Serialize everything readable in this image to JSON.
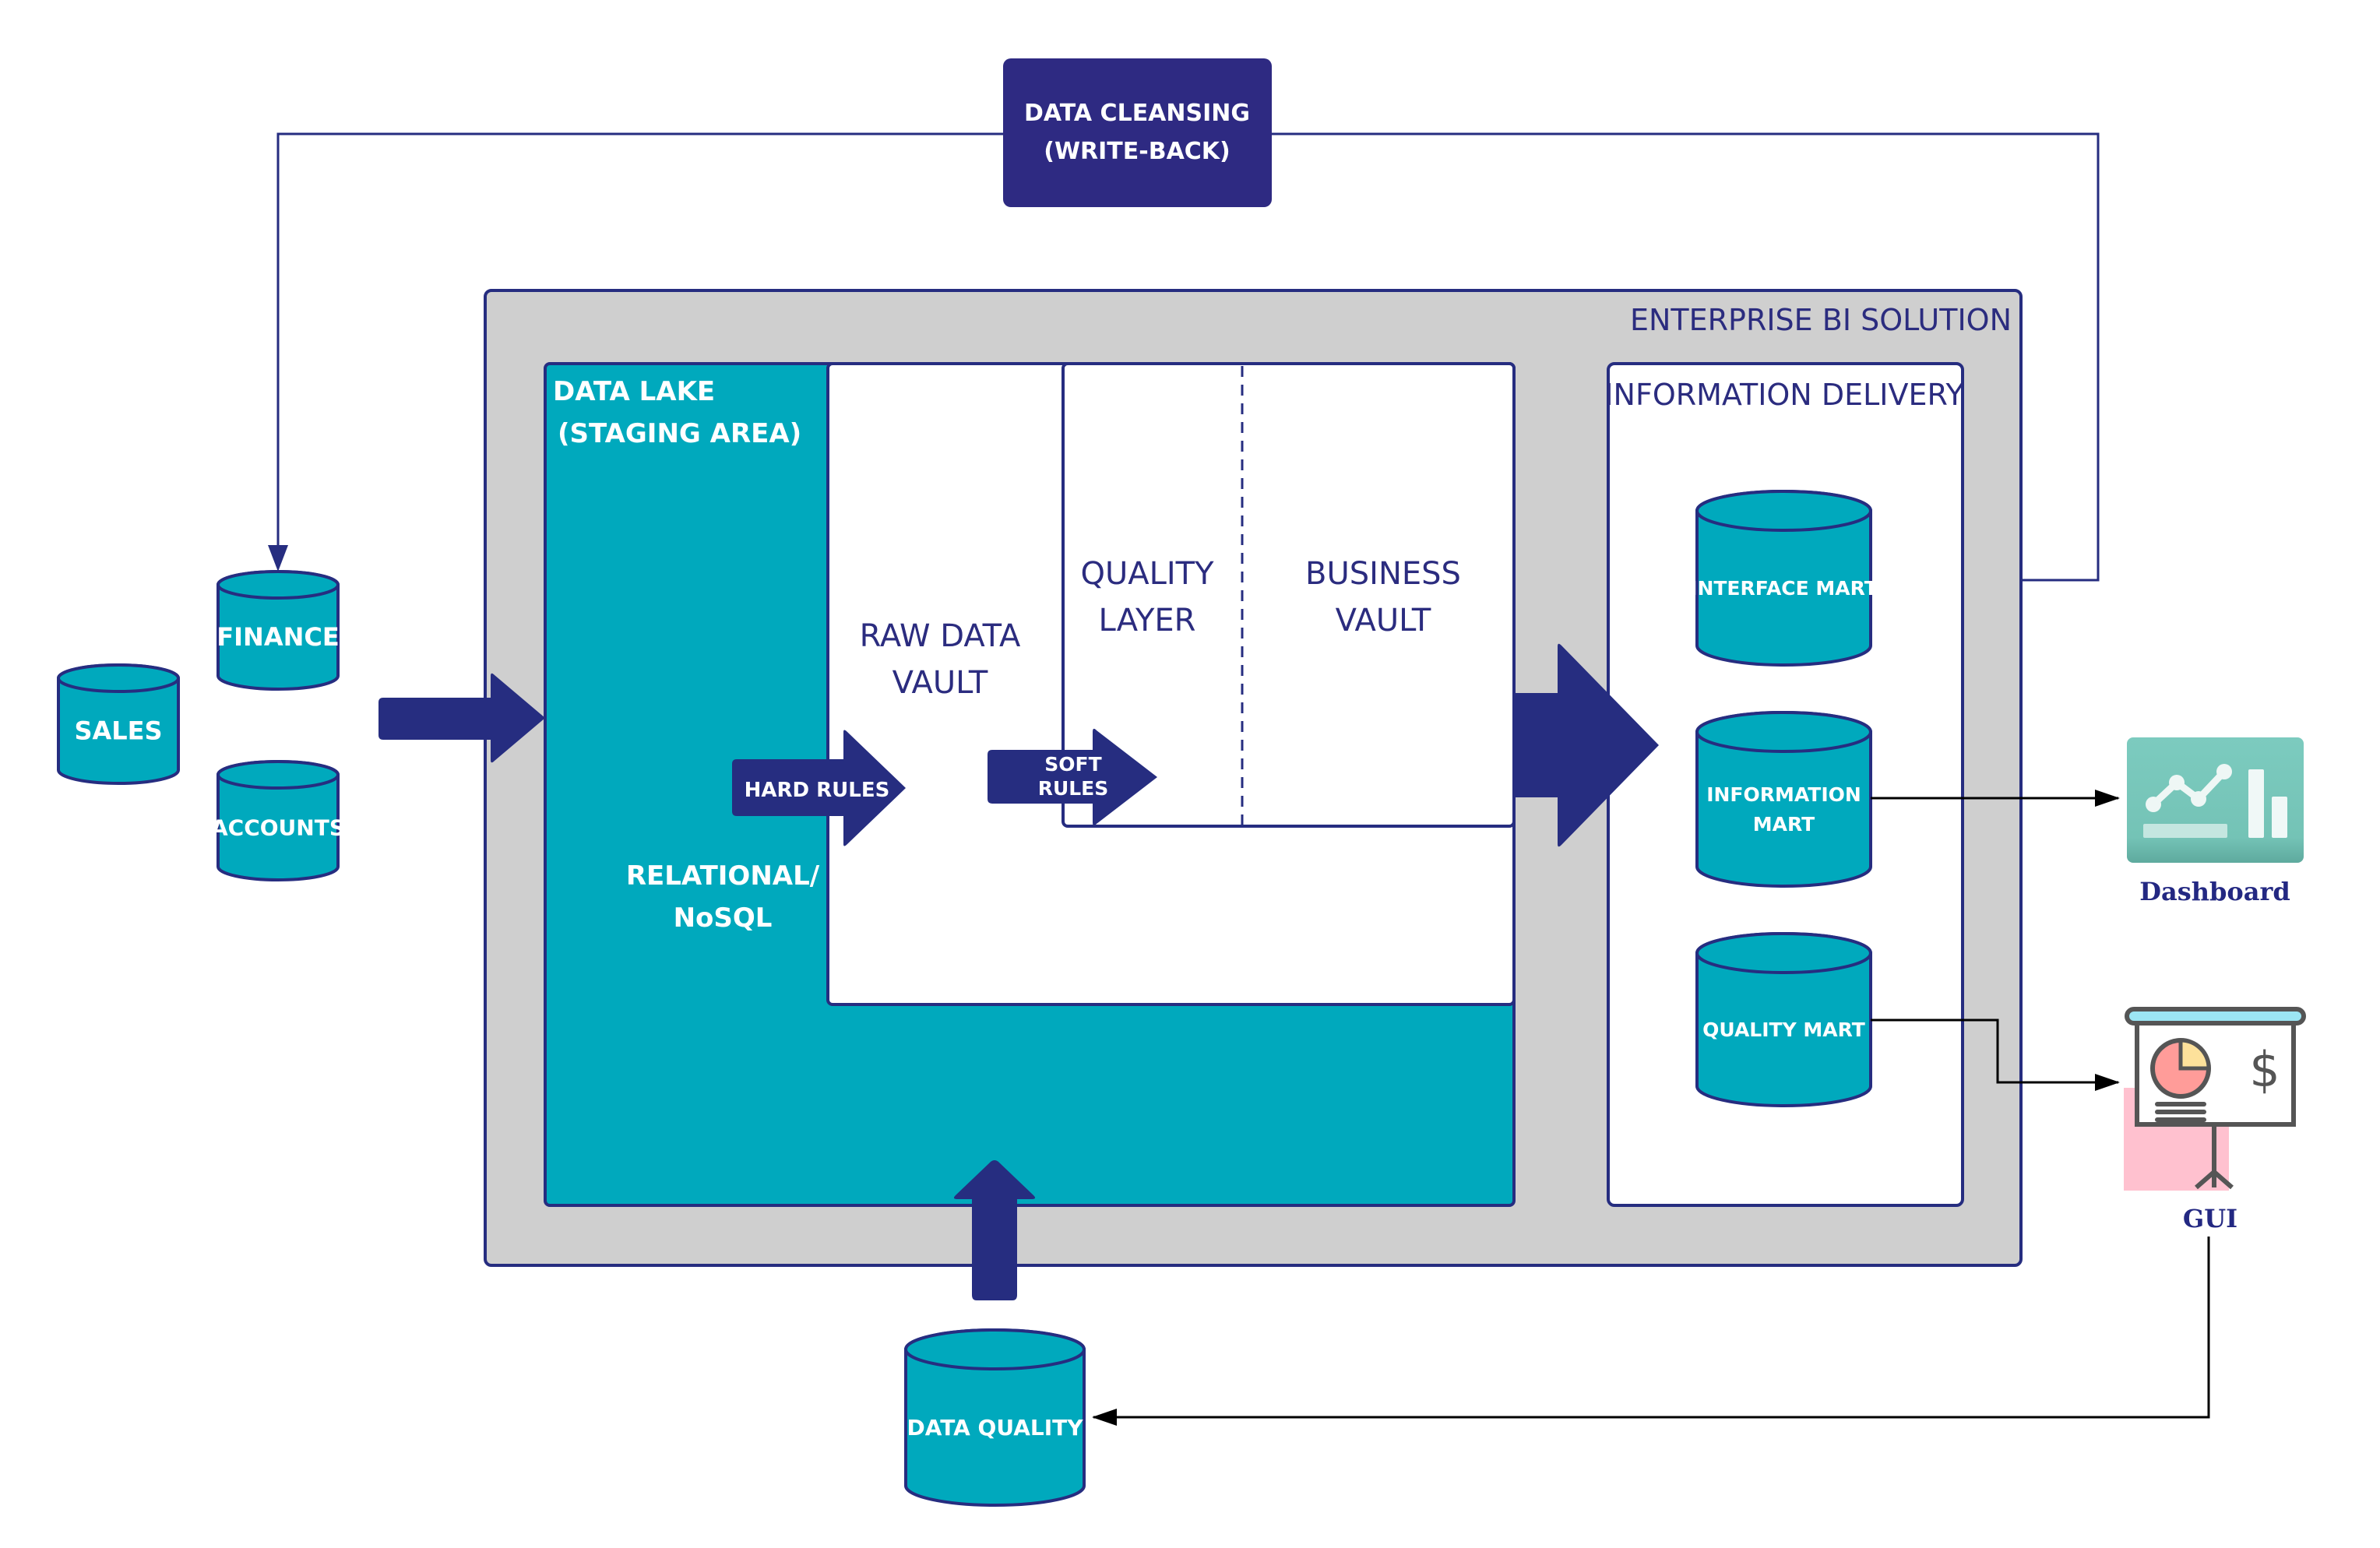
{
  "colors": {
    "navy": "#262d80",
    "teal": "#00a9bd",
    "gray_panel": "#cfcfcf",
    "white": "#ffffff",
    "connector_black": "#000000",
    "dashboard_green": "#79c9bc"
  },
  "write_back": {
    "line1": "DATA CLEANSING",
    "line2": "(WRITE-BACK)"
  },
  "sources": {
    "finance": "FINANCE",
    "sales": "SALES",
    "accounts": "ACCOUNTS"
  },
  "enterprise": {
    "title": "ENTERPRISE BI SOLUTION",
    "data_lake": {
      "line1": "DATA LAKE",
      "line2": "(STAGING AREA)",
      "storage_line1": "RELATIONAL/",
      "storage_line2": "NoSQL"
    },
    "raw_vault": {
      "line1": "RAW DATA",
      "line2": "VAULT"
    },
    "quality_layer": {
      "line1": "QUALITY",
      "line2": "LAYER"
    },
    "business_vault": {
      "line1": "BUSINESS",
      "line2": "VAULT"
    },
    "hard_rules": "HARD RULES",
    "soft_rules": {
      "line1": "SOFT",
      "line2": "RULES"
    },
    "information_delivery": {
      "title": "INFORMATION DELIVERY",
      "marts": [
        {
          "line1": "INTERFACE MART",
          "line2": ""
        },
        {
          "line1": "INFORMATION",
          "line2": "MART"
        },
        {
          "line1": "QUALITY MART",
          "line2": ""
        }
      ]
    }
  },
  "data_quality": "DATA QUALITY",
  "outputs": {
    "dashboard": "Dashboard",
    "gui": "GUI"
  }
}
